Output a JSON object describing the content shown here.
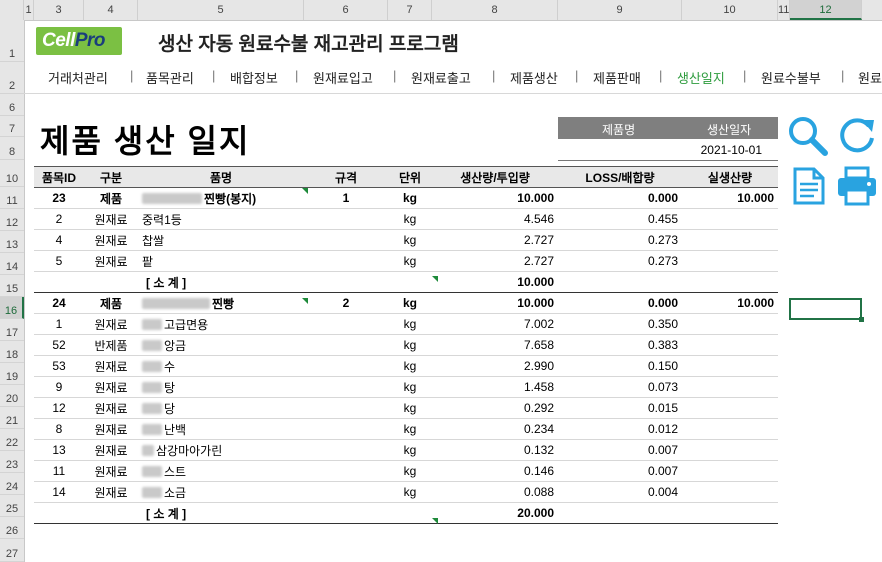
{
  "col_headers": [
    "1",
    "3",
    "4",
    "5",
    "6",
    "7",
    "8",
    "9",
    "10",
    "11",
    "12"
  ],
  "row_headers": [
    "1",
    "2",
    "6",
    "7",
    "8",
    "10",
    "11",
    "12",
    "13",
    "14",
    "15",
    "16",
    "17",
    "18",
    "19",
    "20",
    "21",
    "22",
    "23",
    "24",
    "25",
    "26",
    "27"
  ],
  "logo": {
    "part1": "Cell",
    "part2": "Pro"
  },
  "app_title": "생산 자동 원료수불 재고관리 프로그램",
  "menu": [
    {
      "label": "거래처관리"
    },
    {
      "label": "품목관리"
    },
    {
      "label": "배합정보"
    },
    {
      "label": "원재료입고"
    },
    {
      "label": "원재료출고"
    },
    {
      "label": "제품생산"
    },
    {
      "label": "제품판매"
    },
    {
      "label": "생산일지"
    },
    {
      "label": "원료수불부"
    },
    {
      "label": "원료"
    }
  ],
  "menu_separator": "|",
  "page_title": "제품 생산 일지",
  "info": {
    "product_label": "제품명",
    "date_label": "생산일자",
    "date_value": "2021-10-01"
  },
  "icons": [
    "search-icon",
    "refresh-icon",
    "document-icon",
    "print-icon"
  ],
  "accent_color": "#2e9c3e",
  "icon_color": "#29a3e0",
  "table": {
    "headers": [
      "품목ID",
      "구분",
      "품명",
      "규격",
      "단위",
      "생산량/투입량",
      "LOSS/배합량",
      "실생산량"
    ],
    "rows": [
      {
        "type": "prod",
        "id": "23",
        "kind": "제품",
        "name": "찐빵(봉지)",
        "blur": 60,
        "spec": "1",
        "unit": "kg",
        "qty": "10.000",
        "loss": "0.000",
        "real": "10.000"
      },
      {
        "type": "item",
        "id": "2",
        "kind": "원재료",
        "name": "중력1등",
        "blur": 0,
        "spec": "",
        "unit": "kg",
        "qty": "4.546",
        "loss": "0.455",
        "real": ""
      },
      {
        "type": "item",
        "id": "4",
        "kind": "원재료",
        "name": "찹쌀",
        "blur": 0,
        "spec": "",
        "unit": "kg",
        "qty": "2.727",
        "loss": "0.273",
        "real": ""
      },
      {
        "type": "item",
        "id": "5",
        "kind": "원재료",
        "name": "팥",
        "blur": 0,
        "spec": "",
        "unit": "kg",
        "qty": "2.727",
        "loss": "0.273",
        "real": ""
      },
      {
        "type": "sub",
        "id": "",
        "kind": "",
        "name": "[ 소 계 ]",
        "blur": 0,
        "spec": "",
        "unit": "",
        "qty": "10.000",
        "loss": "",
        "real": ""
      },
      {
        "type": "prod",
        "id": "24",
        "kind": "제품",
        "name": "찐빵",
        "blur": 68,
        "spec": "2",
        "unit": "kg",
        "qty": "10.000",
        "loss": "0.000",
        "real": "10.000"
      },
      {
        "type": "item",
        "id": "1",
        "kind": "원재료",
        "name": "고급면용",
        "blur": 20,
        "spec": "",
        "unit": "kg",
        "qty": "7.002",
        "loss": "0.350",
        "real": ""
      },
      {
        "type": "item",
        "id": "52",
        "kind": "반제품",
        "name": "앙금",
        "blur": 20,
        "spec": "",
        "unit": "kg",
        "qty": "7.658",
        "loss": "0.383",
        "real": ""
      },
      {
        "type": "item",
        "id": "53",
        "kind": "원재료",
        "name": "수",
        "blur": 20,
        "spec": "",
        "unit": "kg",
        "qty": "2.990",
        "loss": "0.150",
        "real": ""
      },
      {
        "type": "item",
        "id": "9",
        "kind": "원재료",
        "name": "탕",
        "blur": 20,
        "spec": "",
        "unit": "kg",
        "qty": "1.458",
        "loss": "0.073",
        "real": ""
      },
      {
        "type": "item",
        "id": "12",
        "kind": "원재료",
        "name": "당",
        "blur": 20,
        "spec": "",
        "unit": "kg",
        "qty": "0.292",
        "loss": "0.015",
        "real": ""
      },
      {
        "type": "item",
        "id": "8",
        "kind": "원재료",
        "name": "난백",
        "blur": 20,
        "spec": "",
        "unit": "kg",
        "qty": "0.234",
        "loss": "0.012",
        "real": ""
      },
      {
        "type": "item",
        "id": "13",
        "kind": "원재료",
        "name": "삼강마아가린",
        "blur": 12,
        "spec": "",
        "unit": "kg",
        "qty": "0.132",
        "loss": "0.007",
        "real": ""
      },
      {
        "type": "item",
        "id": "11",
        "kind": "원재료",
        "name": "스트",
        "blur": 20,
        "spec": "",
        "unit": "kg",
        "qty": "0.146",
        "loss": "0.007",
        "real": ""
      },
      {
        "type": "item",
        "id": "14",
        "kind": "원재료",
        "name": "소금",
        "blur": 20,
        "spec": "",
        "unit": "kg",
        "qty": "0.088",
        "loss": "0.004",
        "real": ""
      },
      {
        "type": "sub",
        "id": "",
        "kind": "",
        "name": "[ 소 계 ]",
        "blur": 0,
        "spec": "",
        "unit": "",
        "qty": "20.000",
        "loss": "",
        "real": ""
      }
    ]
  }
}
